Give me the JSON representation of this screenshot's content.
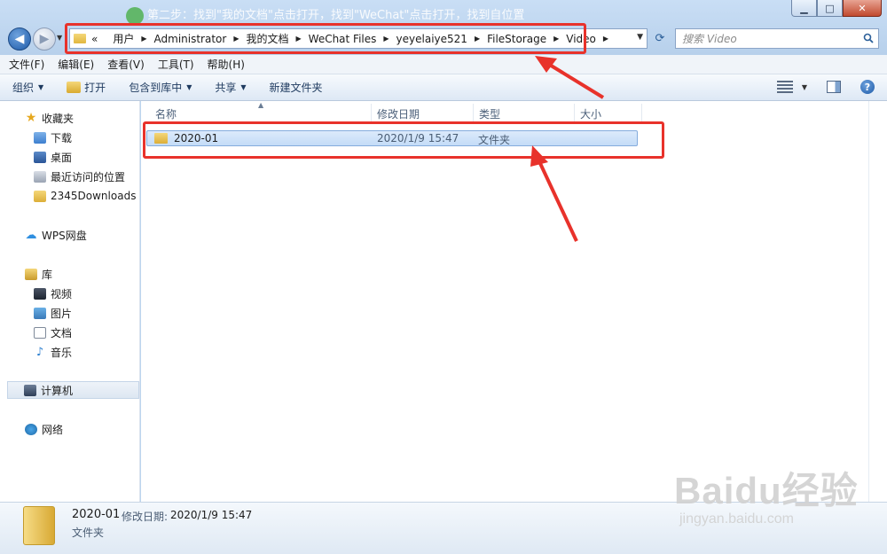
{
  "title_bar": {
    "instruction_text": "第二步：找到\"我的文档\"点击打开，找到\"WeChat\"点击打开，找到自位置",
    "minimize": "▁",
    "maximize": "□",
    "close": "✕"
  },
  "address_bar": {
    "overflow": "«",
    "crumbs": [
      "用户",
      "Administrator",
      "我的文档",
      "WeChat Files",
      "yeyelaiye521",
      "FileStorage",
      "Video"
    ]
  },
  "search": {
    "placeholder": "搜索 Video"
  },
  "menu": [
    "文件(F)",
    "编辑(E)",
    "查看(V)",
    "工具(T)",
    "帮助(H)"
  ],
  "toolbar": {
    "organize": "组织",
    "open": "打开",
    "include_in_library": "包含到库中",
    "share": "共享",
    "new_folder": "新建文件夹"
  },
  "nav_pane": {
    "favorites": "收藏夹",
    "favorites_items": [
      "下载",
      "桌面",
      "最近访问的位置",
      "2345Downloads"
    ],
    "wps": "WPS网盘",
    "libraries": "库",
    "library_items": [
      "视频",
      "图片",
      "文档",
      "音乐"
    ],
    "computer": "计算机",
    "network": "网络"
  },
  "columns": {
    "name": "名称",
    "date": "修改日期",
    "type": "类型",
    "size": "大小"
  },
  "files": [
    {
      "name": "2020-01",
      "date": "2020/1/9 15:47",
      "type": "文件夹",
      "size": ""
    }
  ],
  "details": {
    "name": "2020-01",
    "date_label": "修改日期:",
    "date": "2020/1/9 15:47",
    "type": "文件夹"
  },
  "watermark": {
    "main": "Baidu经验",
    "sub": "jingyan.baidu.com"
  },
  "colors": {
    "annotation": "#e8322b",
    "selection": "#c4dcf7",
    "chrome": "#bcd5ee"
  }
}
